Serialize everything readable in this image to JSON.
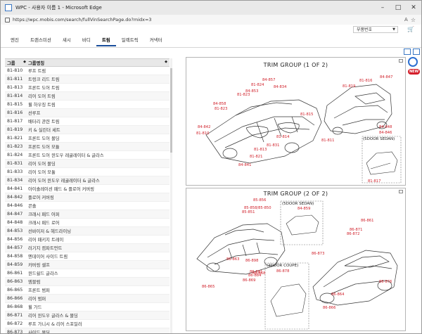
{
  "window": {
    "title": "WPC - 사용자 이름 1 - Microsoft Edge",
    "url": "https://wpc.mobis.com/search/fullVinSearchPage.do?midx=3"
  },
  "header": {
    "search_select": "부품번호"
  },
  "tabs": [
    "엔진",
    "트랜스미션",
    "섀시",
    "바디",
    "트림",
    "일렉트릭",
    "커넥터"
  ],
  "active_tab": "트림",
  "list": {
    "col_group": "그룹",
    "col_name": "그룹명칭",
    "rows": [
      [
        "81-810",
        "루프 트림"
      ],
      [
        "81-811",
        "트렁크 리드 트림"
      ],
      [
        "81-813",
        "프론트 도어 트림"
      ],
      [
        "81-814",
        "리어 도어 트림"
      ],
      [
        "81-815",
        "휠 하우징 트림"
      ],
      [
        "81-816",
        "선루프"
      ],
      [
        "81-817",
        "배터리 관련 트림"
      ],
      [
        "81-819",
        "키 & 실린더 세트"
      ],
      [
        "81-821",
        "프론트 도어 몰딩"
      ],
      [
        "81-823",
        "프론트 도어 모듈"
      ],
      [
        "81-824",
        "프론트 도어 윈도우 레귤레이터 & 글라스"
      ],
      [
        "81-831",
        "리어 도어 몰딩"
      ],
      [
        "81-833",
        "리어 도어 모듈"
      ],
      [
        "81-834",
        "리어 도어 윈도우 레귤레이터 & 글라스"
      ],
      [
        "84-841",
        "아이솔레이션 패드 & 플로어 커버링"
      ],
      [
        "84-842",
        "플로어 커버링"
      ],
      [
        "84-846",
        "콘솔"
      ],
      [
        "84-847",
        "크래시 패드 어퍼"
      ],
      [
        "84-848",
        "크래시 패드 로어"
      ],
      [
        "84-853",
        "선바이저 & 헤드라이닝"
      ],
      [
        "84-856",
        "리어 패키지 트레이"
      ],
      [
        "84-857",
        "러기지 컴파트먼트"
      ],
      [
        "84-858",
        "엔데이어 사이드 트림"
      ],
      [
        "84-859",
        "카버링 셀프"
      ],
      [
        "86-861",
        "윈드쉴드 글라스"
      ],
      [
        "86-863",
        "엠블럼"
      ],
      [
        "86-865",
        "프론트 범퍼"
      ],
      [
        "86-866",
        "리어 범퍼"
      ],
      [
        "86-868",
        "휠 가드"
      ],
      [
        "86-871",
        "리어 윈도우 글라스 & 몰딩"
      ],
      [
        "86-872",
        "루프 가니시 & 리어 스포일러"
      ],
      [
        "86-873",
        "사이드 몰딩"
      ]
    ]
  },
  "diagram1": {
    "title": "TRIM GROUP (1 OF 2)",
    "inset_label": "(5DOOR SEDAN)",
    "labels": [
      "84-857",
      "81-824",
      "84-834",
      "84-853",
      "81-823",
      "84-858",
      "81-823",
      "84-842",
      "81-810",
      "84-841",
      "81-821",
      "81-813",
      "81-831",
      "81-814",
      "84-847",
      "81-816",
      "81-819",
      "81-815",
      "81-811",
      "84-848",
      "84-846",
      "81-817"
    ]
  },
  "diagram2": {
    "title": "TRIM GROUP (2 OF 2)",
    "inset1_label": "(5DOOR SEDAN)",
    "inset2_label": "(2DOOR COUPE)",
    "labels": [
      "85-856",
      "85-858/85-850",
      "85-851",
      "84-859",
      "86-861",
      "86-871",
      "86-872",
      "86-873",
      "86-865",
      "86-868",
      "86-863",
      "86-881",
      "86-884",
      "86-869",
      "86-878",
      "86-864",
      "86-866",
      "86-876",
      "86-898"
    ]
  }
}
